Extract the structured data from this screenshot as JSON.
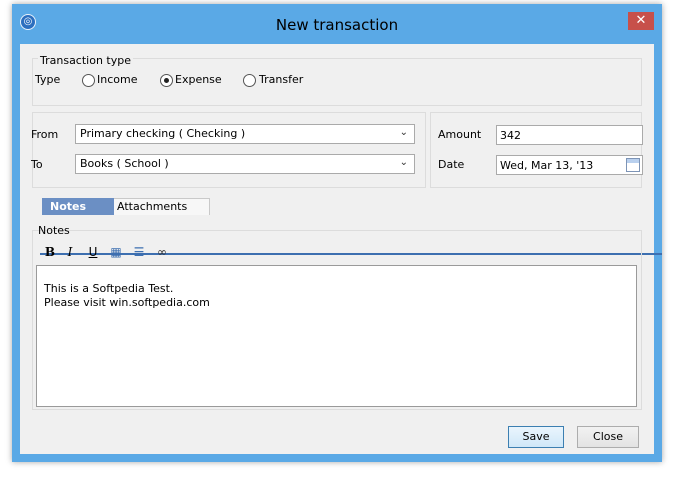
{
  "window": {
    "title": "New transaction",
    "close_glyph": "✕",
    "app_icon": "app-icon"
  },
  "transaction_type": {
    "group_label": "Transaction type",
    "type_label": "Type",
    "options": [
      {
        "label": "Income",
        "selected": false
      },
      {
        "label": "Expense",
        "selected": true
      },
      {
        "label": "Transfer",
        "selected": false
      }
    ]
  },
  "accounts": {
    "from_label": "From",
    "from_value": "Primary checking ( Checking )",
    "to_label": "To",
    "to_value": "Books ( School )"
  },
  "details": {
    "amount_label": "Amount",
    "amount_value": "342",
    "date_label": "Date",
    "date_value": "Wed, Mar 13, '13"
  },
  "tabs": [
    {
      "label": "Notes",
      "active": true
    },
    {
      "label": "Attachments",
      "active": false
    }
  ],
  "notes": {
    "group_label": "Notes",
    "toolbar": [
      {
        "name": "bold-icon",
        "glyph": "B"
      },
      {
        "name": "italic-icon",
        "glyph": "I"
      },
      {
        "name": "underline-icon",
        "glyph": "U"
      },
      {
        "name": "table-icon",
        "glyph": "▦"
      },
      {
        "name": "numbered-list-icon",
        "glyph": "☰"
      },
      {
        "name": "link-icon",
        "glyph": "∞"
      }
    ],
    "lines": [
      "This is a Softpedia Test.",
      "Please visit win.softpedia.com"
    ]
  },
  "buttons": {
    "save": "Save",
    "close": "Close"
  }
}
